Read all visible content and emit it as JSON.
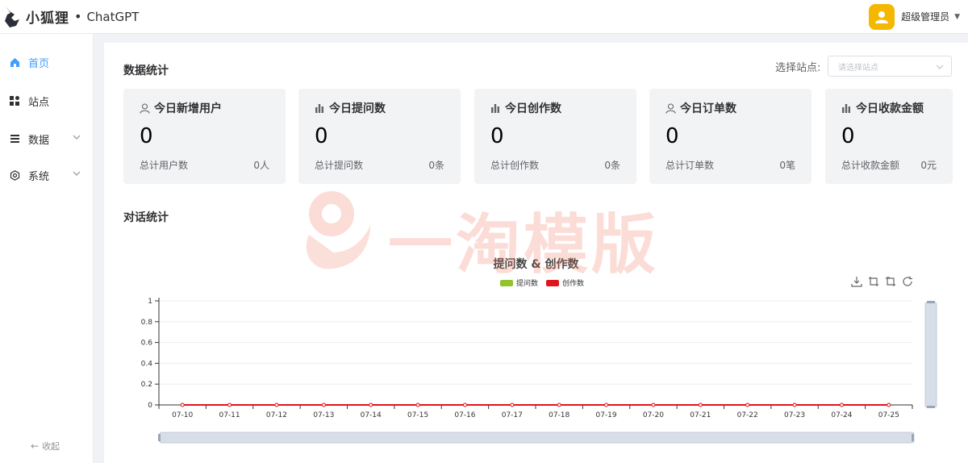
{
  "header": {
    "brand": "小狐狸",
    "brand_dot": "•",
    "brand_sub": "ChatGPT",
    "user_name": "超级管理员"
  },
  "sidebar": {
    "items": [
      {
        "label": "首页",
        "icon": "home-icon",
        "active": true,
        "has_arrow": false
      },
      {
        "label": "站点",
        "icon": "grid-icon",
        "active": false,
        "has_arrow": false
      },
      {
        "label": "数据",
        "icon": "list-icon",
        "active": false,
        "has_arrow": true
      },
      {
        "label": "系统",
        "icon": "gear-icon",
        "active": false,
        "has_arrow": true
      }
    ],
    "collapse_label": "收起"
  },
  "main": {
    "data_title": "数据统计",
    "site_select_label": "选择站点:",
    "site_select_placeholder": "请选择站点",
    "cards": [
      {
        "title": "今日新增用户",
        "icon": "user-icon",
        "value": "0",
        "total_label": "总计用户数",
        "total_value": "0人"
      },
      {
        "title": "今日提问数",
        "icon": "bar-chart-icon",
        "value": "0",
        "total_label": "总计提问数",
        "total_value": "0条"
      },
      {
        "title": "今日创作数",
        "icon": "bar-chart-icon",
        "value": "0",
        "total_label": "总计创作数",
        "total_value": "0条"
      },
      {
        "title": "今日订单数",
        "icon": "user-icon",
        "value": "0",
        "total_label": "总计订单数",
        "total_value": "0笔"
      },
      {
        "title": "今日收款金额",
        "icon": "bar-chart-icon",
        "value": "0",
        "total_label": "总计收款金额",
        "total_value": "0元"
      }
    ],
    "dialog_title": "对话统计"
  },
  "watermark": {
    "text": "一淘模版"
  },
  "chart_data": {
    "type": "line",
    "title": "提问数 & 创作数",
    "categories": [
      "07-10",
      "07-11",
      "07-12",
      "07-13",
      "07-14",
      "07-15",
      "07-16",
      "07-17",
      "07-18",
      "07-19",
      "07-20",
      "07-21",
      "07-22",
      "07-23",
      "07-24",
      "07-25"
    ],
    "series": [
      {
        "name": "提问数",
        "color": "#91c42b",
        "values": [
          0,
          0,
          0,
          0,
          0,
          0,
          0,
          0,
          0,
          0,
          0,
          0,
          0,
          0,
          0,
          0
        ]
      },
      {
        "name": "创作数",
        "color": "#e0141e",
        "values": [
          0,
          0,
          0,
          0,
          0,
          0,
          0,
          0,
          0,
          0,
          0,
          0,
          0,
          0,
          0,
          0
        ]
      }
    ],
    "ylim": [
      0,
      1
    ],
    "yticks": [
      "0",
      "0.2",
      "0.4",
      "0.6",
      "0.8",
      "1"
    ],
    "legend_position": "top-center",
    "grid": true,
    "toolbox": [
      "download-icon",
      "zoom-icon",
      "zoom-reset-icon",
      "restore-icon"
    ]
  }
}
